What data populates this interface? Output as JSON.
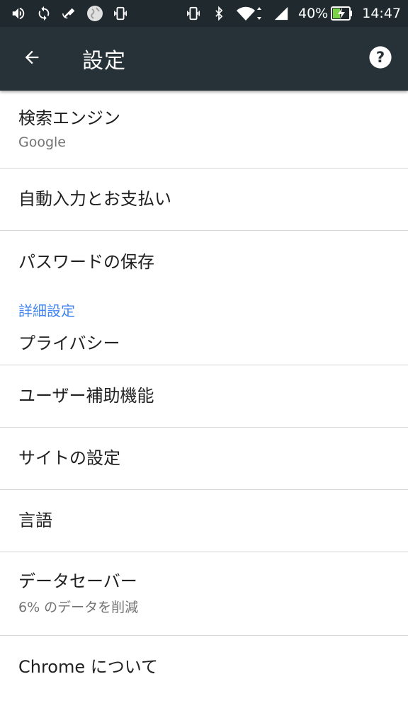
{
  "status_bar": {
    "battery_percent": "40%",
    "time": "14:47",
    "left_icons": [
      "volume-icon",
      "sync-icon",
      "satellite-icon",
      "globe-icon",
      "vibrate-icon"
    ],
    "right_icons": [
      "vibrate-icon",
      "bluetooth-icon",
      "wifi-icon",
      "signal-icon",
      "battery-charging-icon"
    ]
  },
  "app_bar": {
    "title": "設定",
    "back_icon": "arrow-back-icon",
    "help_icon": "help-icon"
  },
  "settings": {
    "search_engine": {
      "title": "検索エンジン",
      "subtitle": "Google"
    },
    "autofill": {
      "title": "自動入力とお支払い"
    },
    "passwords": {
      "title": "パスワードの保存"
    },
    "advanced_header": "詳細設定",
    "privacy": {
      "title": "プライバシー"
    },
    "accessibility": {
      "title": "ユーザー補助機能"
    },
    "site_settings": {
      "title": "サイトの設定"
    },
    "language": {
      "title": "言語"
    },
    "data_saver": {
      "title": "データセーバー",
      "subtitle": "6% のデータを削減"
    },
    "about": {
      "title": "Chrome について"
    }
  },
  "colors": {
    "status_bar_bg": "#1f292e",
    "app_bar_bg": "#263238",
    "section_header": "#4285f4",
    "divider": "#d6d6d6"
  }
}
